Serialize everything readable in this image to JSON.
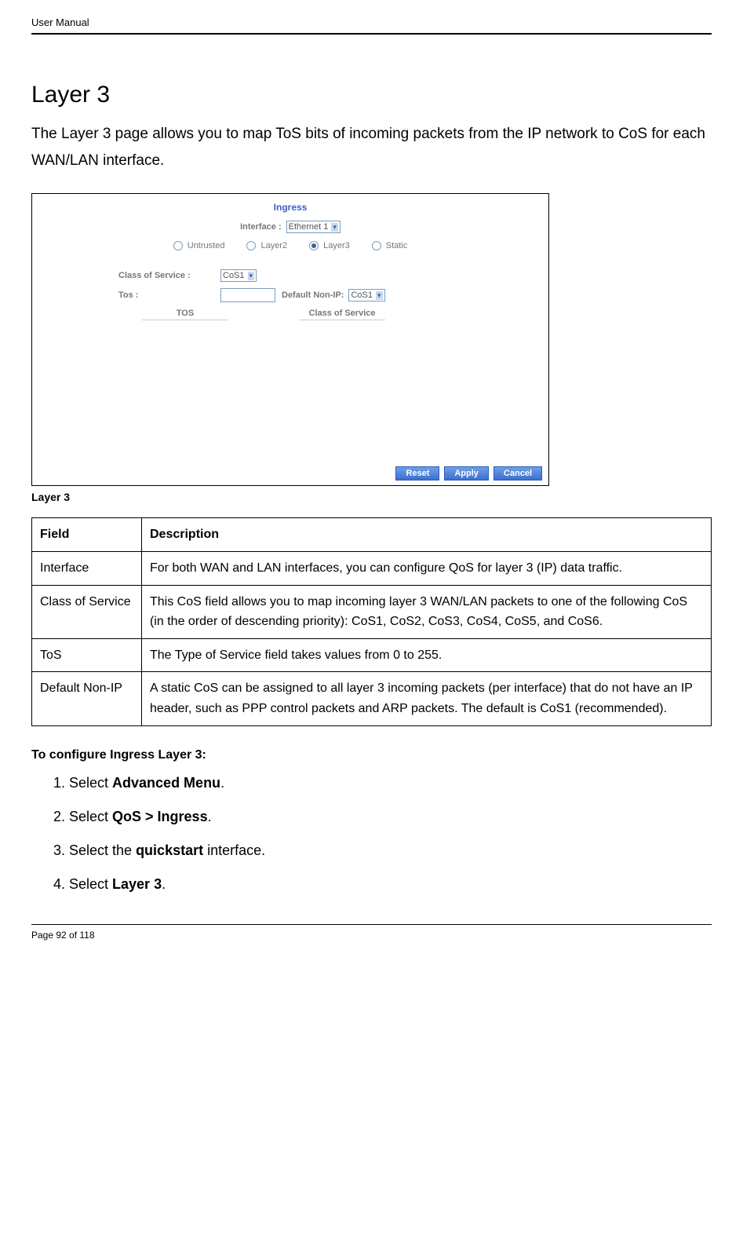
{
  "header": {
    "doc_title": "User Manual"
  },
  "page": {
    "title": "Layer 3",
    "intro": "The Layer 3 page allows you to map ToS bits of incoming packets from the IP network to CoS for each WAN/LAN interface."
  },
  "screenshot": {
    "title": "Ingress",
    "interface_label": "Interface :",
    "interface_value": "Ethernet 1",
    "radios": {
      "untrusted": "Untrusted",
      "layer2": "Layer2",
      "layer3": "Layer3",
      "static": "Static",
      "selected": "layer3"
    },
    "cos_label": "Class of Service :",
    "cos_value": "CoS1",
    "tos_label": "Tos :",
    "tos_value": "",
    "default_nonip_label": "Default Non-IP:",
    "default_nonip_value": "CoS1",
    "col_tos": "TOS",
    "col_cos": "Class of Service",
    "buttons": {
      "reset": "Reset",
      "apply": "Apply",
      "cancel": "Cancel"
    }
  },
  "caption": "Layer 3",
  "table": {
    "headers": {
      "field": "Field",
      "description": "Description"
    },
    "rows": [
      {
        "field": "Interface",
        "desc": "For both WAN and LAN interfaces, you can configure QoS for layer 3 (IP) data traffic."
      },
      {
        "field": "Class of Service",
        "desc": "This CoS field allows you to map incoming layer 3 WAN/LAN packets to one of the following CoS (in the order of descending priority): CoS1, CoS2, CoS3, CoS4, CoS5, and CoS6."
      },
      {
        "field": "ToS",
        "desc": "The Type of Service field takes values from 0 to 255."
      },
      {
        "field": "Default Non-IP",
        "desc": "A static CoS can be assigned to all layer 3 incoming packets (per interface) that do not have an IP header, such as PPP control packets and ARP packets. The default is CoS1 (recommended)."
      }
    ]
  },
  "instructions": {
    "heading": "To configure Ingress Layer 3:",
    "steps": [
      {
        "prefix": "Select ",
        "bold": "Advanced Menu",
        "suffix": "."
      },
      {
        "prefix": "Select ",
        "bold": "QoS > Ingress",
        "suffix": "."
      },
      {
        "prefix": "Select the ",
        "bold": "quickstart",
        "suffix": " interface."
      },
      {
        "prefix": "Select ",
        "bold": "Layer 3",
        "suffix": "."
      }
    ]
  },
  "footer": {
    "page_info": "Page 92 of 118"
  }
}
